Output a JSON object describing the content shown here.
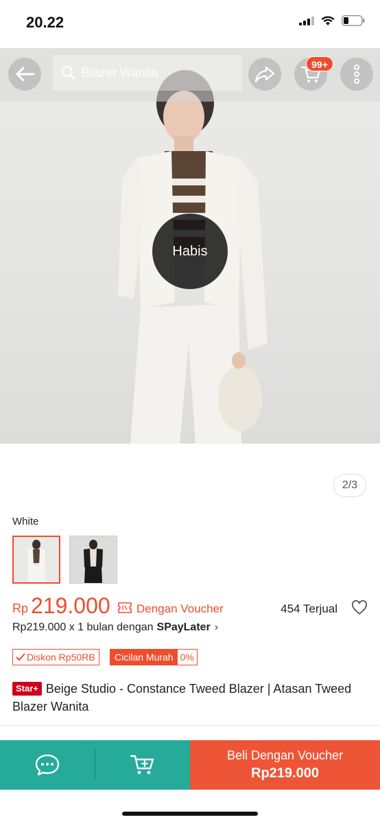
{
  "status_bar": {
    "time": "20.22"
  },
  "header": {
    "search_placeholder": "Blazer Wanita",
    "cart_badge": "99+"
  },
  "gallery": {
    "sold_out_label": "Habis",
    "page_indicator": "2/3"
  },
  "variant": {
    "label": "White",
    "options": [
      "White",
      "Black"
    ]
  },
  "price": {
    "currency": "Rp",
    "amount": "219.000",
    "voucher_label": "Dengan Voucher",
    "sold": "454 Terjual"
  },
  "paylater": {
    "text": "Rp219.000 x 1 bulan dengan",
    "brand": "SPayLater",
    "chevron": "›"
  },
  "tags": {
    "discount": "Diskon Rp50RB",
    "cicilan": "Cicilan Murah",
    "cicilan_rate": "0%"
  },
  "product": {
    "badge": "Star+",
    "title": "Beige Studio - Constance Tweed Blazer | Atasan Tweed Blazer Wanita"
  },
  "bottom_bar": {
    "buy_label": "Beli Dengan Voucher",
    "buy_price": "Rp219.000"
  },
  "colors": {
    "accent": "#ee4d2d",
    "chat_bar": "#26aa99",
    "buy_button": "#ee5536"
  }
}
